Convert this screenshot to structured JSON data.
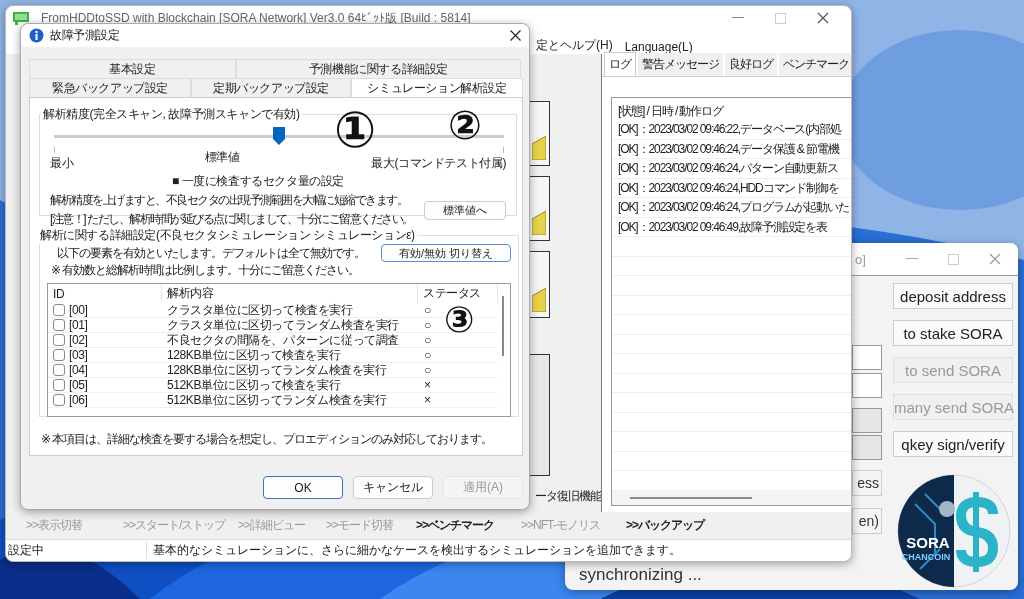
{
  "main_window": {
    "title": "FromHDDtoSSD with Blockchain [SORA Network] Ver3.0 64ﾋﾞｯﾄ版 [Build : 5814]",
    "menu": [
      "定とヘルプ(H)",
      "Language(L)"
    ],
    "side_label": "ータ復旧機能",
    "log_tabs": [
      {
        "label": "ログ",
        "selected": true
      },
      {
        "label": "警告メッセージ",
        "selected": false
      },
      {
        "label": "良好ログ",
        "selected": false
      },
      {
        "label": "ベンチマーク",
        "selected": false
      }
    ],
    "log_header": "[状態] / 日時 / 動作ログ",
    "log_rows": [
      "[OK]：2023/03/02 09:46:22,データベース(内部処",
      "[OK]：2023/03/02 09:46:24,データ保護 & 節電機",
      "[OK]：2023/03/02 09:46:24,パターン自動更新ス",
      "[OK]：2023/03/02 09:46:24,HDDコマンド制御を",
      "[OK]：2023/03/02 09:46:24,プログラムが起動いた",
      "[OK]：2023/03/02 09:46:49,故障予測設定を表"
    ],
    "nav": [
      {
        "label": ">>表示切替",
        "disabled": true
      },
      {
        "label": ">>スタート/ストップ",
        "disabled": true
      },
      {
        "label": ">>詳細ビュー",
        "disabled": true
      },
      {
        "label": ">>モード切替",
        "disabled": true
      },
      {
        "label": ">>ベンチマーク",
        "disabled": false
      },
      {
        "label": ">>NFT-モノリス",
        "disabled": true
      },
      {
        "label": ">>バックアップ",
        "disabled": false
      }
    ],
    "status_bar": {
      "state": "設定中",
      "message": "基本的なシミュレーションに、さらに細かなケースを検出するシミュレーションを追加できます。"
    }
  },
  "wallet_window": {
    "title": "o]",
    "partial_buttons": [
      "ess",
      "en)"
    ],
    "buttons": [
      {
        "label": "deposit address",
        "disabled": false
      },
      {
        "label": "to stake SORA",
        "disabled": false
      },
      {
        "label": "to send SORA",
        "disabled": true
      },
      {
        "label": "many send SORA",
        "disabled": true
      },
      {
        "label": "qkey sign/verify",
        "disabled": false
      }
    ],
    "logo_text": [
      "SORA",
      "CHANCOIN"
    ],
    "status": "synchronizing ..."
  },
  "dialog": {
    "title": "故障予測設定",
    "tab_rows": [
      [
        {
          "label": "基本設定",
          "selected": false
        },
        {
          "label": "予測機能に関する詳細設定",
          "selected": false
        }
      ],
      [
        {
          "label": "緊急バックアップ設定",
          "selected": false
        },
        {
          "label": "定期バックアップ設定",
          "selected": false
        },
        {
          "label": "シミュレーション解析設定",
          "selected": true
        }
      ]
    ],
    "precision": {
      "legend": "解析精度(完全スキャン, 故障予測スキャンで有効)",
      "level": 0.5,
      "min_label": "最小",
      "mid_label": "標準値",
      "max_label": "最大(コマンドテスト付属)",
      "sector_label": "■ 一度に検査するセクタ量の設定",
      "description": [
        "解析精度を上げますと、不良セクタの出現予測範囲を大幅に短縮できます。",
        "[注意！] ただし、解析時間が延びる点に関しまして、十分にご留意ください。"
      ],
      "reset_button": "標準値へ"
    },
    "detail": {
      "legend": "解析に関する詳細設定(不良セクタシミュレーション シミュレーションε)",
      "lines": [
        "以下の要素を有効といたします。デフォルトは全て無効です。",
        "※ 有効数と総解析時間は比例します。十分にご留意ください。"
      ],
      "toggle_button": "有効/無効 切り替え",
      "columns": [
        "ID",
        "解析内容",
        "ステータス"
      ],
      "rows": [
        {
          "id": "[00]",
          "content": "クラスタ単位に区切って検査を実行",
          "status": "○",
          "checked": false
        },
        {
          "id": "[01]",
          "content": "クラスタ単位に区切ってランダム検査を実行",
          "status": "○",
          "checked": false
        },
        {
          "id": "[02]",
          "content": "不良セクタの間隔を、パターンに従って調査",
          "status": "○",
          "checked": false
        },
        {
          "id": "[03]",
          "content": "128KB単位に区切って検査を実行",
          "status": "○",
          "checked": false
        },
        {
          "id": "[04]",
          "content": "128KB単位に区切ってランダム検査を実行",
          "status": "○",
          "checked": false
        },
        {
          "id": "[05]",
          "content": "512KB単位に区切って検査を実行",
          "status": "×",
          "checked": false
        },
        {
          "id": "[06]",
          "content": "512KB単位に区切ってランダム検査を実行",
          "status": "×",
          "checked": false
        }
      ]
    },
    "note": "※ 本項目は、詳細な検査を要する場合を想定し、プロエディションのみ対応しております。",
    "buttons": [
      {
        "label": "OK",
        "kind": "default",
        "disabled": false
      },
      {
        "label": "キャンセル",
        "kind": "normal",
        "disabled": false
      },
      {
        "label": "適用(A)",
        "kind": "normal",
        "disabled": true
      }
    ]
  },
  "annotations": [
    "①",
    "②",
    "③"
  ]
}
